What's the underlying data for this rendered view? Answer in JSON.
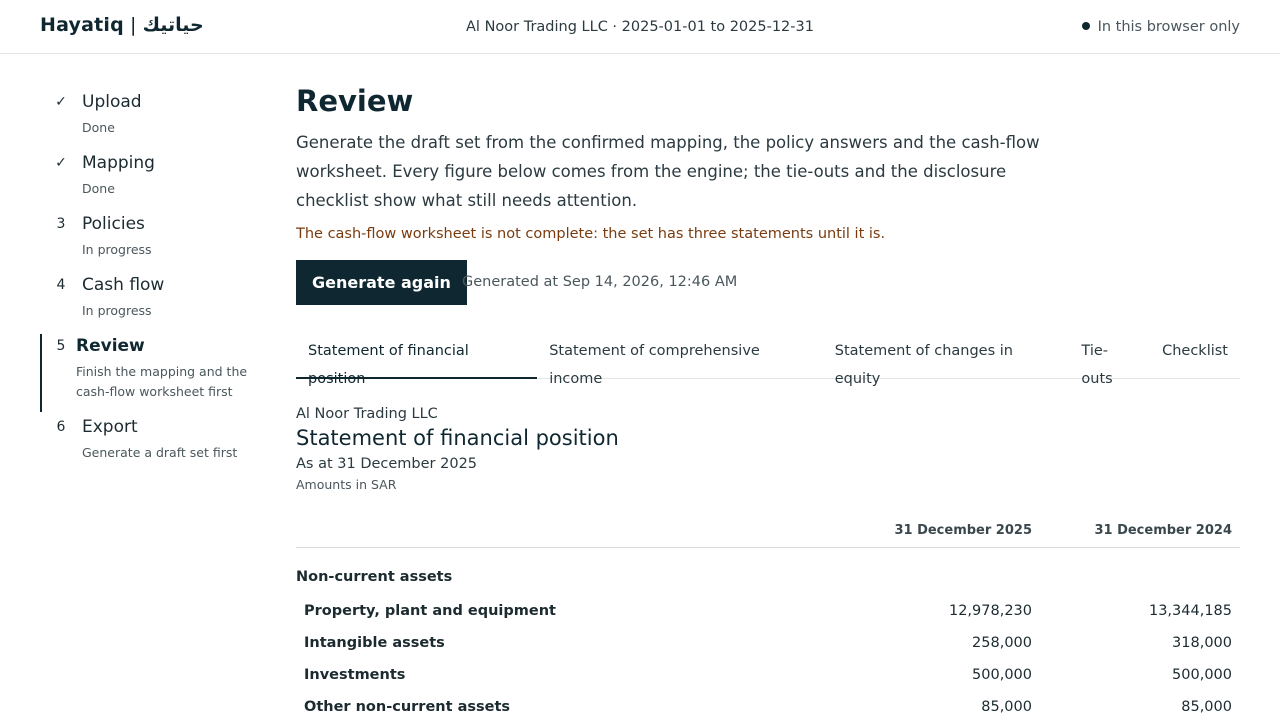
{
  "brand": {
    "name": "Hayatiq",
    "separator": "|",
    "arabic_name": "حياتيك"
  },
  "context": "Al Noor Trading LLC · 2025-01-01 to 2025-12-31",
  "privacy": {
    "label": "In this browser only"
  },
  "steps": [
    {
      "num": "✓",
      "label": "Upload",
      "status": "Done"
    },
    {
      "num": "✓",
      "label": "Mapping",
      "status": "Done"
    },
    {
      "num": "3",
      "label": "Policies",
      "status": "In progress"
    },
    {
      "num": "4",
      "label": "Cash flow",
      "status": "In progress"
    },
    {
      "num": "5",
      "label": "Review",
      "status": "Finish the mapping and the cash-flow worksheet first"
    },
    {
      "num": "6",
      "label": "Export",
      "status": "Generate a draft set first"
    }
  ],
  "review": {
    "title": "Review",
    "intro": "Generate the draft set from the confirmed mapping, the policy answers and the cash-flow worksheet. Every figure below comes from the engine; the tie-outs and the disclosure checklist show what still needs attention.",
    "warning": "The cash-flow worksheet is not complete: the set has three statements until it is.",
    "generate_label": "Generate again",
    "generated_at": "Generated at Sep 14, 2026, 12:46 AM"
  },
  "tabs": [
    {
      "label": "Statement of financial position"
    },
    {
      "label": "Statement of comprehensive income"
    },
    {
      "label": "Statement of changes in equity"
    },
    {
      "label": "Tie-outs"
    },
    {
      "label": "Checklist"
    }
  ],
  "statement": {
    "entity": "Al Noor Trading LLC",
    "title": "Statement of financial position",
    "as_at": "As at 31 December 2025",
    "units": "Amounts in SAR",
    "columns": [
      "31 December 2025",
      "31 December 2024"
    ],
    "group": "Non-current assets",
    "rows": [
      {
        "label": "Property, plant and equipment",
        "current": "12,978,230",
        "prior": "13,344,185"
      },
      {
        "label": "Intangible assets",
        "current": "258,000",
        "prior": "318,000"
      },
      {
        "label": "Investments",
        "current": "500,000",
        "prior": "500,000"
      },
      {
        "label": "Other non-current assets",
        "current": "85,000",
        "prior": "85,000"
      }
    ]
  }
}
